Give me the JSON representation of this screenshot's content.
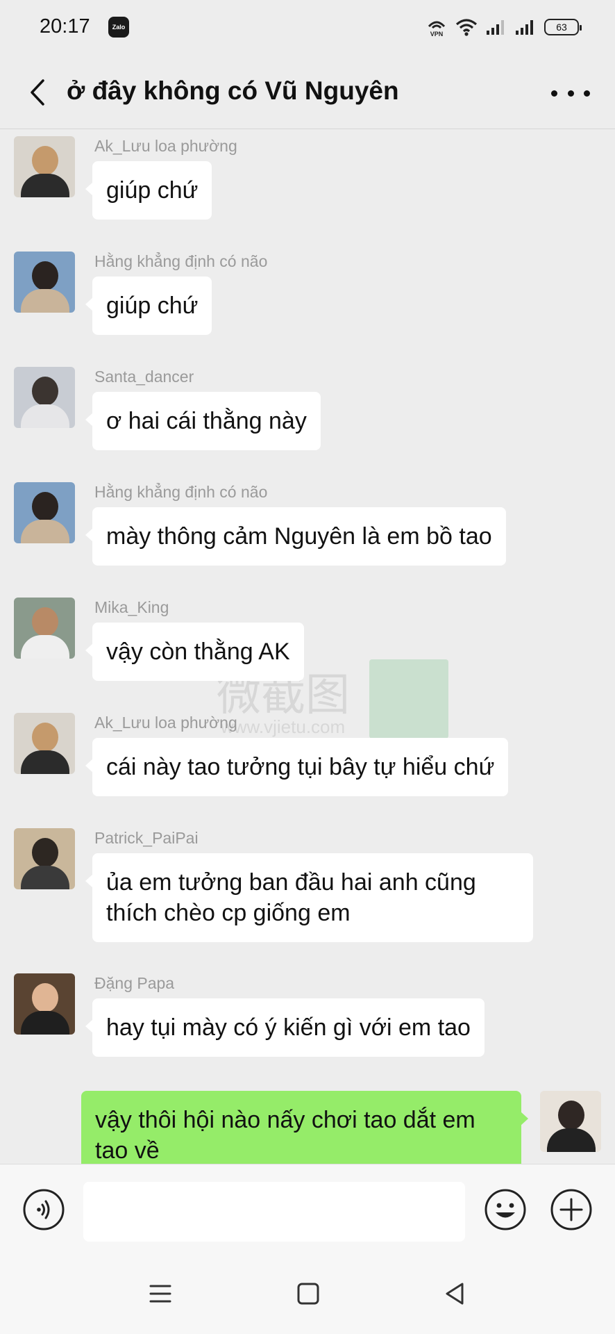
{
  "status_bar": {
    "time": "20:17",
    "app_badge": "Zalo",
    "vpn_label": "VPN",
    "battery": "63"
  },
  "header": {
    "title": "ở đây không có Vũ Nguyên"
  },
  "messages": [
    {
      "sender": "Ak_Lưu loa phường",
      "text": "giúp chứ",
      "avatar_icon": "avatar-ak-luu"
    },
    {
      "sender": "Hằng khẳng định có não",
      "text": "giúp chứ",
      "avatar_icon": "avatar-hang"
    },
    {
      "sender": "Santa_dancer",
      "text": "ơ hai cái thằng này",
      "avatar_icon": "avatar-santa"
    },
    {
      "sender": "Hằng khẳng định có não",
      "text": "mày thông cảm Nguyên là em bồ tao",
      "avatar_icon": "avatar-hang"
    },
    {
      "sender": "Mika_King",
      "text": "vậy còn thằng AK",
      "avatar_icon": "avatar-mika"
    },
    {
      "sender": "Ak_Lưu loa phường",
      "text": "cái này tao tưởng tụi bây tự hiểu chứ",
      "avatar_icon": "avatar-ak-luu"
    },
    {
      "sender": "Patrick_PaiPai",
      "text": "ủa em tưởng ban đầu hai anh cũng thích chèo cp giống em",
      "avatar_icon": "avatar-patrick"
    },
    {
      "sender": "Đặng Papa",
      "text": "hay tụi mày có ý kiến gì với em tao",
      "avatar_icon": "avatar-dang"
    },
    {
      "sender": "",
      "text": "vậy thôi hội nào nấy chơi tao dắt em tao về",
      "avatar_icon": "avatar-me",
      "mine": true
    }
  ],
  "watermark": {
    "text": "微截图",
    "url": "www.vjietu.com"
  },
  "input_bar": {
    "placeholder": ""
  },
  "colors": {
    "background": "#ededed",
    "bubble_in": "#ffffff",
    "bubble_out": "#95ec69",
    "sender_text": "#9a9a9a"
  }
}
